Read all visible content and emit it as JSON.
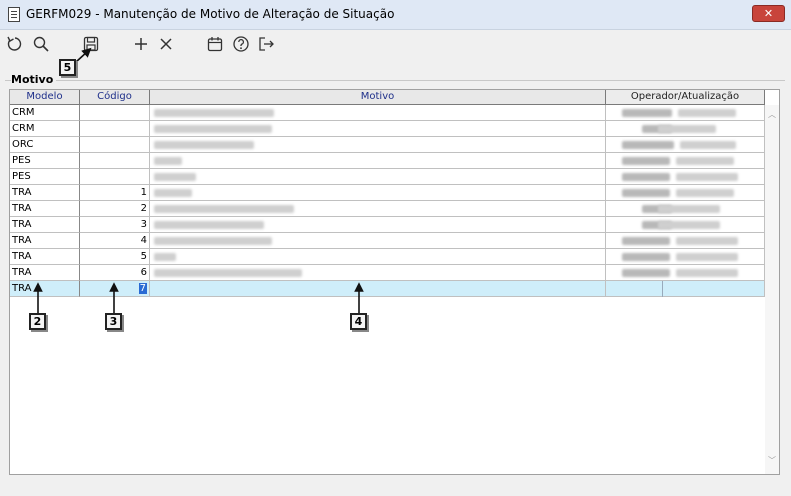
{
  "window": {
    "title": "GERFM029 - Manutenção de Motivo de Alteração de Situação",
    "close_label": "✕"
  },
  "toolbar": [
    {
      "name": "refresh-icon"
    },
    {
      "name": "search-icon"
    },
    {
      "name": "save-icon"
    },
    {
      "name": "add-icon"
    },
    {
      "name": "delete-icon"
    },
    {
      "name": "calendar-icon"
    },
    {
      "name": "help-icon"
    },
    {
      "name": "exit-icon"
    }
  ],
  "group": {
    "label": "Motivo"
  },
  "table": {
    "columns": [
      "Modelo",
      "Código",
      "Motivo",
      "Operador/Atualização"
    ],
    "rows": [
      {
        "modelo": "CRM",
        "codigo": ""
      },
      {
        "modelo": "CRM",
        "codigo": ""
      },
      {
        "modelo": "ORC",
        "codigo": ""
      },
      {
        "modelo": "PES",
        "codigo": ""
      },
      {
        "modelo": "PES",
        "codigo": ""
      },
      {
        "modelo": "TRA",
        "codigo": "1"
      },
      {
        "modelo": "TRA",
        "codigo": "2"
      },
      {
        "modelo": "TRA",
        "codigo": "3"
      },
      {
        "modelo": "TRA",
        "codigo": "4"
      },
      {
        "modelo": "TRA",
        "codigo": "5"
      },
      {
        "modelo": "TRA",
        "codigo": "6"
      }
    ],
    "selected_row": {
      "modelo": "TRA",
      "codigo": "7"
    }
  },
  "callouts": {
    "c5": "5",
    "c2": "2",
    "c3": "3",
    "c4": "4"
  },
  "colors": {
    "selection": "#cfeefa",
    "header_text": "#1e2f8a",
    "close": "#c8443b"
  }
}
